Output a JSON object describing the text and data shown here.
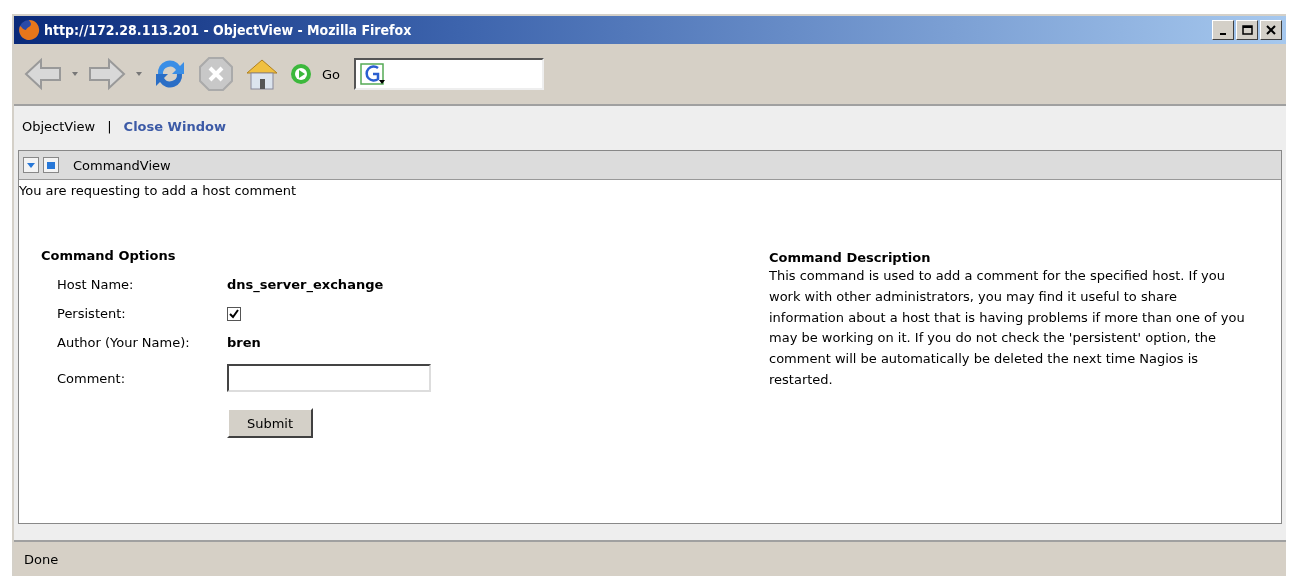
{
  "window": {
    "title": "http://172.28.113.201 - ObjectView - Mozilla Firefox"
  },
  "toolbar": {
    "go_label": "Go"
  },
  "nav": [
    {
      "kind": "text",
      "label": "ObjectView"
    },
    {
      "kind": "separator",
      "label": "|"
    },
    {
      "kind": "link",
      "label": "Close Window"
    }
  ],
  "panel": {
    "title": "CommandView",
    "intro": "You are requesting to add a host comment",
    "options": {
      "title": "Command Options",
      "fields": [
        {
          "kind": "value",
          "label": "Host Name:",
          "value": "dns_server_exchange"
        },
        {
          "kind": "checkbox",
          "label": "Persistent:",
          "checked": true
        },
        {
          "kind": "value",
          "label": "Author (Your Name):",
          "value": "bren"
        },
        {
          "kind": "input",
          "label": "Comment:"
        }
      ],
      "submit": "Submit"
    },
    "description": {
      "title": "Command Description",
      "text": "This command is used to add a comment for the specified host. If you work with other administrators, you may find it useful to share information about a host that is having problems if more than one of you may be working on it. If you do not check the 'persistent' option, the comment will be automatically be deleted the next time Nagios is restarted."
    }
  },
  "status_bar": "Done"
}
